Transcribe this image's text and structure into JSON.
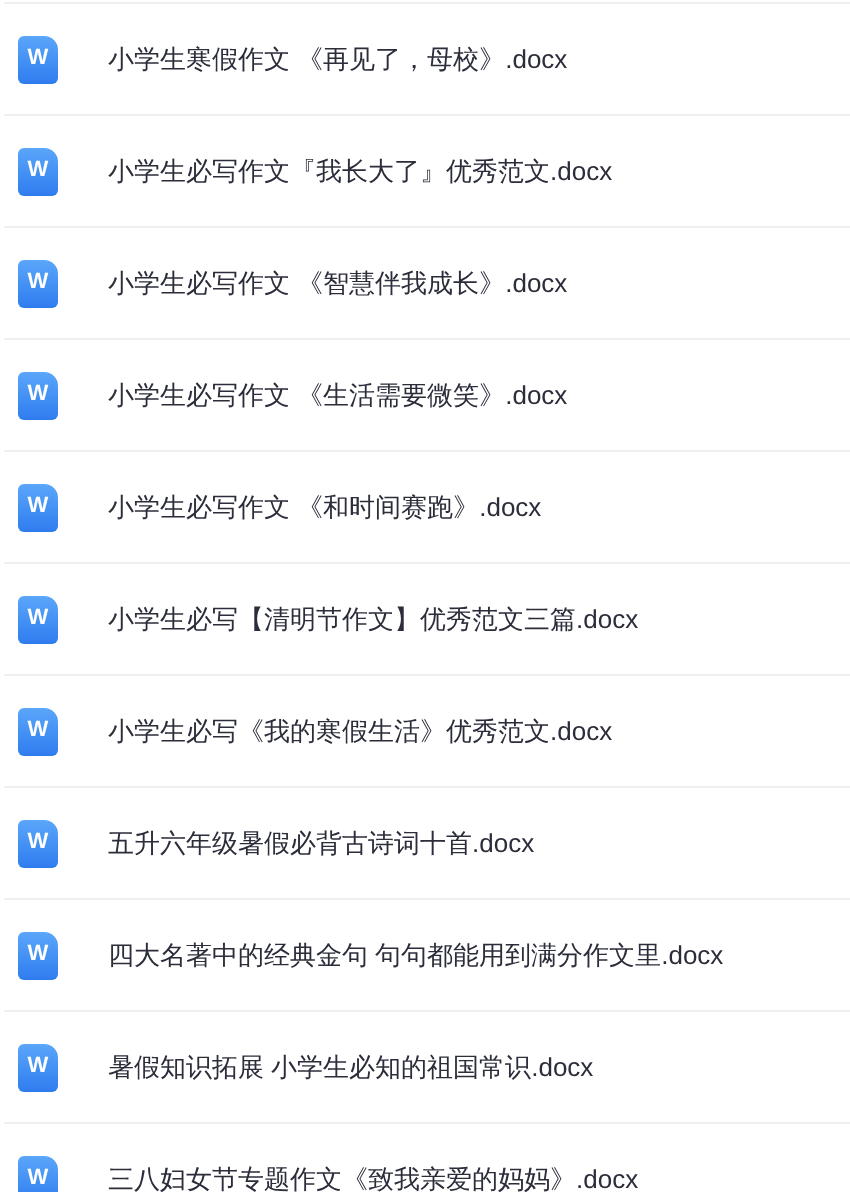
{
  "files": [
    {
      "icon_letter": "W",
      "name": "小学生寒假作文 《再见了，母校》.docx"
    },
    {
      "icon_letter": "W",
      "name": "小学生必写作文『我长大了』优秀范文.docx"
    },
    {
      "icon_letter": "W",
      "name": "小学生必写作文 《智慧伴我成长》.docx"
    },
    {
      "icon_letter": "W",
      "name": "小学生必写作文 《生活需要微笑》.docx"
    },
    {
      "icon_letter": "W",
      "name": "小学生必写作文 《和时间赛跑》.docx"
    },
    {
      "icon_letter": "W",
      "name": "小学生必写【清明节作文】优秀范文三篇.docx"
    },
    {
      "icon_letter": "W",
      "name": "小学生必写《我的寒假生活》优秀范文.docx"
    },
    {
      "icon_letter": "W",
      "name": "五升六年级暑假必背古诗词十首.docx"
    },
    {
      "icon_letter": "W",
      "name": "四大名著中的经典金句 句句都能用到满分作文里.docx"
    },
    {
      "icon_letter": "W",
      "name": "暑假知识拓展 小学生必知的祖国常识.docx"
    },
    {
      "icon_letter": "W",
      "name": "三八妇女节专题作文《致我亲爱的妈妈》.docx"
    }
  ]
}
